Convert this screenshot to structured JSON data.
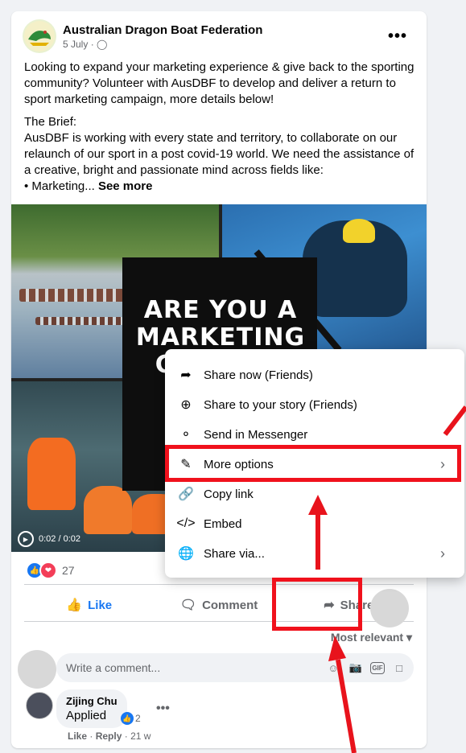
{
  "post": {
    "page_name": "Australian Dragon Boat Federation",
    "date": "5 July",
    "para1": "Looking to expand your marketing experience & give back to the sporting community? Volunteer with AusDBF to develop and deliver a return to sport marketing campaign, more details below!",
    "brief_title": "The Brief:",
    "para2": "AusDBF is working with every state and territory, to collaborate on our relaunch of our sport in a post covid-19 world. We need the assistance of a creative, bright and passionate mind across fields like:",
    "bullet": "• Marketing...",
    "see_more": "See more"
  },
  "media": {
    "overlay_text": "ARE YOU A MARKETING GURU OR",
    "video_time": "0:02 / 0:02"
  },
  "reactions": {
    "count": "27"
  },
  "actions": {
    "like": "Like",
    "comment": "Comment",
    "share": "Share"
  },
  "comments": {
    "sort": "Most relevant",
    "placeholder": "Write a comment...",
    "reply": {
      "name": "Zijing Chu",
      "text": "Applied",
      "react_count": "2",
      "like": "Like",
      "reply_label": "Reply",
      "age": "21 w"
    }
  },
  "share_menu": {
    "items": [
      {
        "label": "Share now (Friends)"
      },
      {
        "label": "Share to your story (Friends)"
      },
      {
        "label": "Send in Messenger"
      },
      {
        "label": "More options"
      },
      {
        "label": "Copy link"
      },
      {
        "label": "Embed"
      },
      {
        "label": "Share via..."
      }
    ]
  },
  "colors": {
    "accent": "#1877f2",
    "annotation": "#f0111c"
  }
}
